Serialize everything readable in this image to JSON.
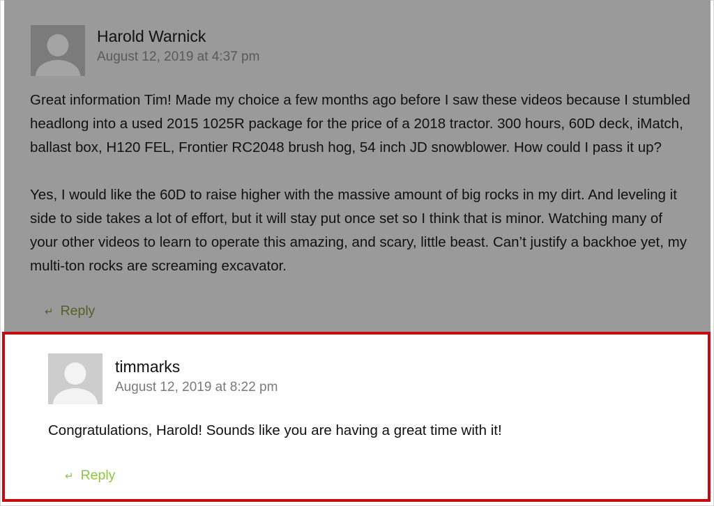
{
  "comments": [
    {
      "author": "Harold Warnick",
      "date": "August 12, 2019 at 4:37 pm",
      "paragraphs": [
        "Great information Tim! Made my choice a few months ago before I saw these videos because I stumbled headlong into a used 2015 1025R package for the price of a 2018 tractor. 300 hours, 60D deck, iMatch, ballast box, H120 FEL, Frontier RC2048 brush hog, 54 inch JD snowblower. How could I pass it up?",
        "Yes, I would like the 60D to raise higher with the massive amount of big rocks in my dirt. And leveling it side to side takes a lot of effort, but it will stay put once set so I think that is minor. Watching many of your other videos to learn to operate this amazing, and scary, little beast. Can’t justify a backhoe yet, my multi-ton rocks are screaming excavator."
      ],
      "reply_label": "Reply",
      "avatar_icon": "default-user-avatar-icon"
    },
    {
      "author": "timmarks",
      "date": "August 12, 2019 at 8:22 pm",
      "paragraphs": [
        "Congratulations, Harold! Sounds like you are having a great time with it!"
      ],
      "reply_label": "Reply",
      "avatar_icon": "default-user-avatar-icon"
    }
  ],
  "colors": {
    "overlay": "#9a9a9a",
    "highlight_border": "#c00d12",
    "reply_link": "#8cc63e"
  }
}
